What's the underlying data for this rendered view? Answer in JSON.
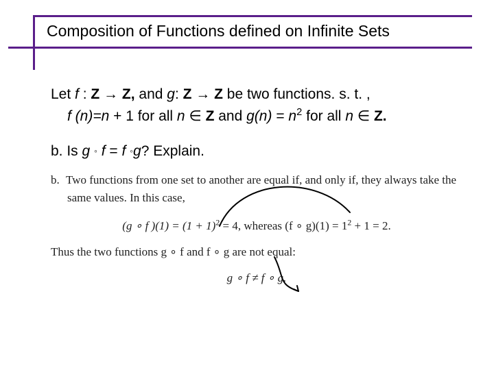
{
  "title": "Composition of Functions defined on Infinite Sets",
  "body": {
    "line1_pre": "Let ",
    "line1_f": "f",
    "line1_colon1": " : ",
    "line1_Z1": "Z",
    "line1_arrow1": " → ",
    "line1_Z2": "Z",
    "line1_comma": ", ",
    "line1_mid": "and ",
    "line1_g": "g",
    "line1_colon2": ": ",
    "line1_Z3": "Z",
    "line1_arrow2": " → ",
    "line1_Z4": "Z",
    "line1_end": " be two functions. s. t. ,",
    "line2_f": "f ",
    "line2_paren": "(n)=n",
    "line2_plus": " + 1 for all ",
    "line2_n1": "n",
    "line2_in1": " ∈ ",
    "line2_Z1": "Z",
    "line2_and": " and ",
    "line2_gn": "g(n)",
    "line2_eq": " = ",
    "line2_n2": "n",
    "line2_sq": "2",
    "line2_for": " for all ",
    "line2_n3": "n",
    "line2_in2": " ∈ ",
    "line2_Z2": "Z",
    "line2_period": ".",
    "line3_pre": "b. Is ",
    "line3_g1": "g ",
    "line3_circ1": "◦",
    "line3_f1": " f",
    "line3_eq": " = ",
    "line3_f2": "f ",
    "line3_circ2": "◦",
    "line3_g2": "g",
    "line3_end": "? Explain."
  },
  "excerpt": {
    "b_label": "b.",
    "row1a": "Two functions from one set to another are equal if, and only if, they always take the",
    "row2": "same values. In this case,",
    "formula_lhs": "(g ∘ f )(1) = (1 + 1)",
    "formula_sq1": "2",
    "formula_mid": " = 4,   whereas   (f ∘ g)(1) = 1",
    "formula_sq2": "2",
    "formula_rhs": " + 1 = 2.",
    "row3": "Thus the two functions g ∘ f  and  f ∘ g are not equal:",
    "final": "g ∘ f ≠ f ∘ g."
  }
}
